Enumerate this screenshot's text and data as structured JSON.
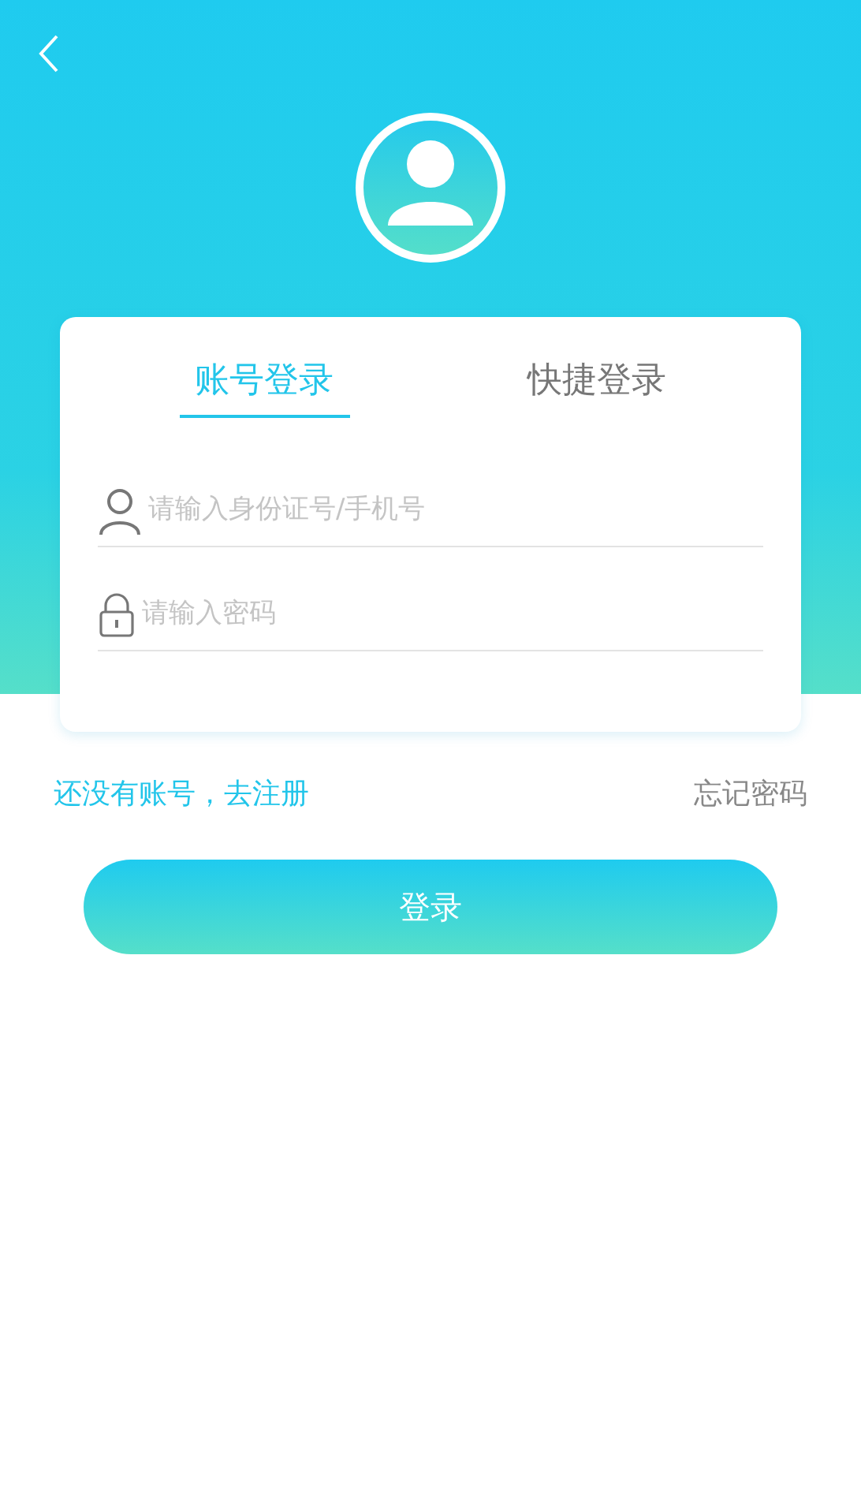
{
  "tabs": [
    {
      "label": "账号登录",
      "selected": true
    },
    {
      "label": "快捷登录",
      "selected": false
    }
  ],
  "fields": [
    {
      "kind": "account",
      "placeholder": "请输入身份证号/手机号"
    },
    {
      "kind": "password",
      "placeholder": "请输入密码"
    }
  ],
  "register_link": "还没有账号，去注册",
  "forgot_link": "忘记密码",
  "login_button": "登录"
}
